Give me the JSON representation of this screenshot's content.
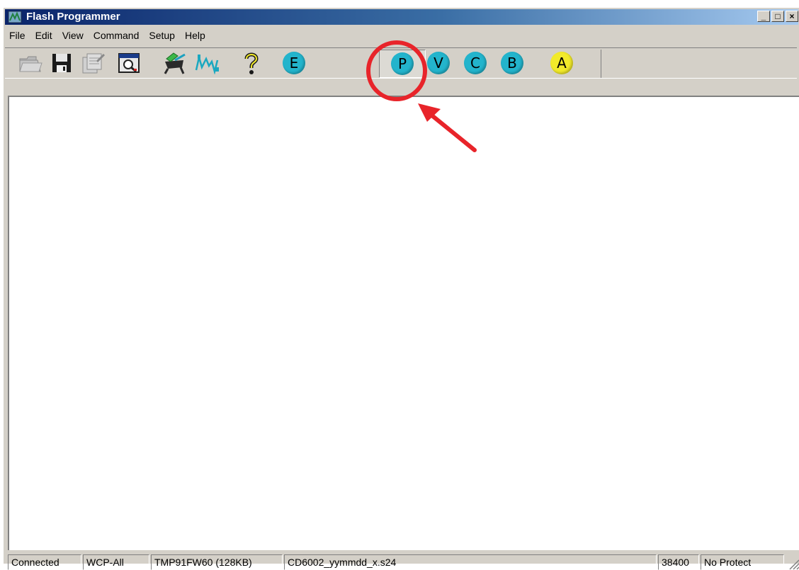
{
  "window": {
    "title": "Flash Programmer",
    "controls": [
      "_",
      "□",
      "×"
    ]
  },
  "menu": [
    "File",
    "Edit",
    "View",
    "Command",
    "Setup",
    "Help"
  ],
  "toolbar": {
    "icons": [
      "open-folder-icon",
      "save-disk-icon",
      "properties-icon",
      "view-buffer-icon",
      "device-select-icon",
      "waveform-icon",
      "help-icon"
    ],
    "buttons": [
      {
        "label": "E",
        "color": "#23b4cc"
      },
      {
        "label": "P",
        "color": "#23b4cc",
        "pressed": true
      },
      {
        "label": "V",
        "color": "#23b4cc"
      },
      {
        "label": "C",
        "color": "#23b4cc"
      },
      {
        "label": "B",
        "color": "#23b4cc"
      },
      {
        "label": "A",
        "color": "#f2ea2a"
      }
    ]
  },
  "status": {
    "connection": "Connected",
    "mode": "WCP-All",
    "device": "TMP91FW60 (128KB)",
    "file": "CD6002_yymmdd_x.s24",
    "baud": "38400",
    "protect": "No Protect"
  },
  "annotation_color": "#e8242a"
}
